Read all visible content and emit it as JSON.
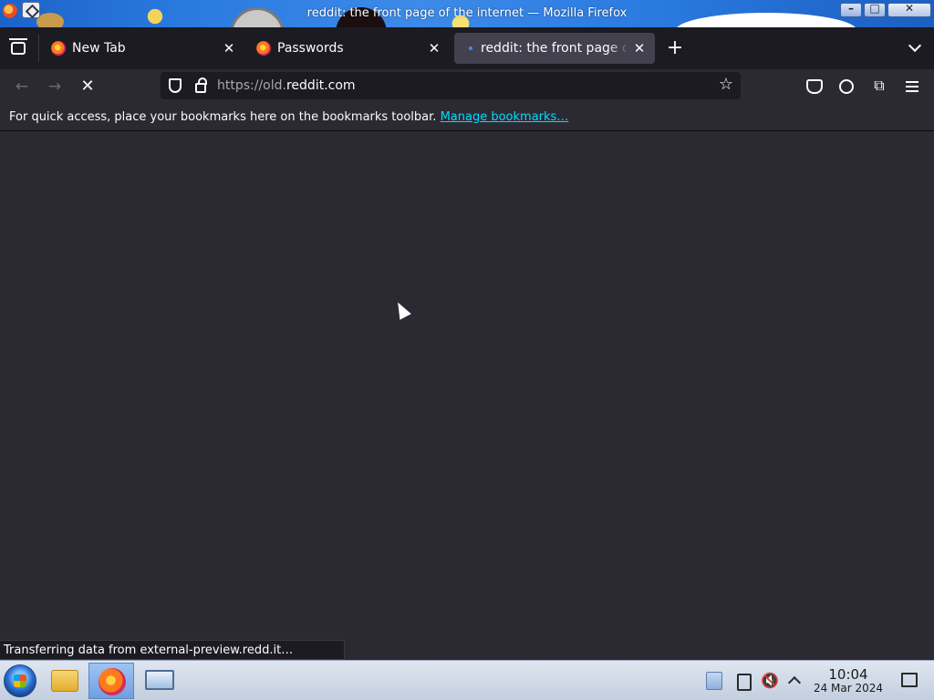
{
  "window": {
    "title": "reddit: the front page of the internet — Mozilla Firefox",
    "controls": {
      "minimize": "–",
      "maximize": "□",
      "close": "✕"
    }
  },
  "tabs": [
    {
      "label": "New Tab",
      "close": "✕"
    },
    {
      "label": "Passwords",
      "close": "✕"
    },
    {
      "label": "reddit: the front page of the internet",
      "close": "✕",
      "active": true,
      "loading": true
    }
  ],
  "toolbar": {
    "new_tab": "+",
    "back": "←",
    "forward": "→",
    "stop": "✕",
    "url_prefix": "https://old.",
    "url_domain": "reddit.com",
    "bookmark_star": "☆",
    "extensions": "⧉"
  },
  "bookmarks_bar": {
    "hint": "For quick access, place your bookmarks here on the bookmarks toolbar.",
    "manage_link": "Manage bookmarks…"
  },
  "status": {
    "text": "Transferring data from external-preview.redd.it…"
  },
  "taskbar": {
    "volume_icon": "🔇",
    "clock_time": "10:04",
    "clock_date": "24 Mar 2024"
  },
  "icons": {
    "title_app": "firefox-icon",
    "title_pin": "pin-icon",
    "tab_list": "tab-list-icon",
    "overflow": "chevron-down-icon",
    "tracking": "shield-icon",
    "secure": "lock-icon",
    "pocket": "pocket-icon",
    "account": "account-icon",
    "menu": "hamburger-menu-icon"
  },
  "colors": {
    "page_bg": "#2b2a33",
    "tabstrip_bg": "#1c1b22",
    "active_tab": "#42414d",
    "link": "#00ddff",
    "titlebar": "#2a7ae0"
  }
}
